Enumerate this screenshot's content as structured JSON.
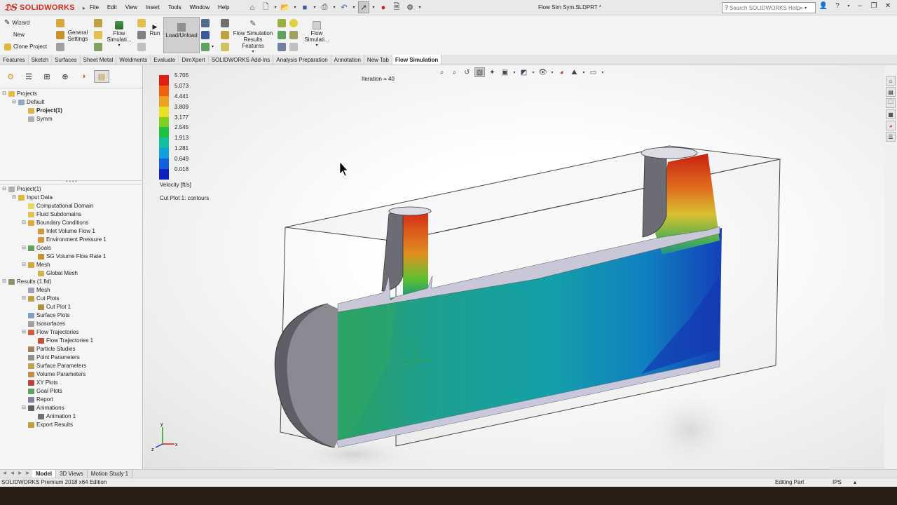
{
  "app": {
    "brand": "SOLIDWORKS",
    "document_title": "Flow Sim Sym.SLDPRT *",
    "menu": [
      "File",
      "Edit",
      "View",
      "Insert",
      "Tools",
      "Window",
      "Help"
    ],
    "search_placeholder": "Search SOLIDWORKS Help"
  },
  "ribbon": {
    "wizard": "Wizard",
    "new": "New",
    "clone_project": "Clone Project",
    "general_settings": "General Settings",
    "flow_simulation_1": "Flow Simulati...",
    "run": "Run",
    "load_unload": "Load/Unload",
    "results_features": "Flow Simulation Results Features",
    "flow_simulation_2": "Flow Simulati..."
  },
  "tabs": [
    {
      "label": "Features",
      "active": false
    },
    {
      "label": "Sketch",
      "active": false
    },
    {
      "label": "Surfaces",
      "active": false
    },
    {
      "label": "Sheet Metal",
      "active": false
    },
    {
      "label": "Weldments",
      "active": false
    },
    {
      "label": "Evaluate",
      "active": false
    },
    {
      "label": "DimXpert",
      "active": false
    },
    {
      "label": "SOLIDWORKS Add-Ins",
      "active": false
    },
    {
      "label": "Analysis Preparation",
      "active": false
    },
    {
      "label": "Annotation",
      "active": false
    },
    {
      "label": "New Tab",
      "active": false
    },
    {
      "label": "Flow Simulation",
      "active": true
    }
  ],
  "project_tree": [
    {
      "label": "Projects",
      "level": 0,
      "exp": "-",
      "icon": "#e8b84a",
      "bold": false
    },
    {
      "label": "Default",
      "level": 1,
      "exp": "-",
      "icon": "#8fa8c8",
      "bold": false
    },
    {
      "label": "Project(1)",
      "level": 2,
      "exp": "",
      "icon": "#d9b24a",
      "bold": true
    },
    {
      "label": "Symm",
      "level": 2,
      "exp": "",
      "icon": "#b0b0b0",
      "bold": false
    }
  ],
  "analysis_tree": [
    {
      "label": "Project(1)",
      "level": 0,
      "exp": "-",
      "icon": "#b0b0b0"
    },
    {
      "label": "Input Data",
      "level": 1,
      "exp": "-",
      "icon": "#e0b840"
    },
    {
      "label": "Computational Domain",
      "level": 2,
      "exp": "",
      "icon": "#e8d860"
    },
    {
      "label": "Fluid Subdomains",
      "level": 2,
      "exp": "",
      "icon": "#e0c050"
    },
    {
      "label": "Boundary Conditions",
      "level": 2,
      "exp": "-",
      "icon": "#e0a840"
    },
    {
      "label": "Inlet Volume Flow 1",
      "level": 3,
      "exp": "",
      "icon": "#d09840"
    },
    {
      "label": "Environment Pressure 1",
      "level": 3,
      "exp": "",
      "icon": "#d09840"
    },
    {
      "label": "Goals",
      "level": 2,
      "exp": "-",
      "icon": "#60a060"
    },
    {
      "label": "SG Volume Flow Rate 1",
      "level": 3,
      "exp": "",
      "icon": "#c89030"
    },
    {
      "label": "Mesh",
      "level": 2,
      "exp": "-",
      "icon": "#d0a840"
    },
    {
      "label": "Global Mesh",
      "level": 3,
      "exp": "",
      "icon": "#d0b050"
    },
    {
      "label": "Results (1.fld)",
      "level": 0,
      "exp": "-",
      "icon": "#909060"
    },
    {
      "label": "Mesh",
      "level": 2,
      "exp": "",
      "icon": "#a0a0c0"
    },
    {
      "label": "Cut Plots",
      "level": 2,
      "exp": "-",
      "icon": "#c0a040"
    },
    {
      "label": "Cut Plot 1",
      "level": 3,
      "exp": "",
      "icon": "#b09040"
    },
    {
      "label": "Surface Plots",
      "level": 2,
      "exp": "",
      "icon": "#80a0c0"
    },
    {
      "label": "Isosurfaces",
      "level": 2,
      "exp": "",
      "icon": "#a0a0a0"
    },
    {
      "label": "Flow Trajectories",
      "level": 2,
      "exp": "-",
      "icon": "#d06040"
    },
    {
      "label": "Flow Trajectories 1",
      "level": 3,
      "exp": "",
      "icon": "#c05040"
    },
    {
      "label": "Particle Studies",
      "level": 2,
      "exp": "",
      "icon": "#a08060"
    },
    {
      "label": "Point Parameters",
      "level": 2,
      "exp": "",
      "icon": "#909090"
    },
    {
      "label": "Surface Parameters",
      "level": 2,
      "exp": "",
      "icon": "#c0a050"
    },
    {
      "label": "Volume Parameters",
      "level": 2,
      "exp": "",
      "icon": "#c09050"
    },
    {
      "label": "XY Plots",
      "level": 2,
      "exp": "",
      "icon": "#c04040"
    },
    {
      "label": "Goal Plots",
      "level": 2,
      "exp": "",
      "icon": "#60a060"
    },
    {
      "label": "Report",
      "level": 2,
      "exp": "",
      "icon": "#8080a0"
    },
    {
      "label": "Animations",
      "level": 2,
      "exp": "-",
      "icon": "#606060"
    },
    {
      "label": "Animation 1",
      "level": 3,
      "exp": "",
      "icon": "#707070"
    },
    {
      "label": "Export Results",
      "level": 2,
      "exp": "",
      "icon": "#c0a040"
    }
  ],
  "viewport": {
    "iteration": "Iteration = 40",
    "legend_values": [
      "5.705",
      "5.073",
      "4.441",
      "3.809",
      "3.177",
      "2.545",
      "1.913",
      "1.281",
      "0.649",
      "0.018"
    ],
    "legend_colors": [
      "#e02010",
      "#f06010",
      "#f0a020",
      "#e8e020",
      "#80d020",
      "#20c040",
      "#10c0a0",
      "#10a0e0",
      "#1060e0",
      "#1020c0"
    ],
    "legend_title": "Velocity [ft/s]",
    "cut_plot_label": "Cut Plot 1: contours",
    "axis_x": "x",
    "axis_y": "y",
    "axis_z": "z"
  },
  "bottom_tabs": [
    {
      "label": "Model",
      "active": true
    },
    {
      "label": "3D Views",
      "active": false
    },
    {
      "label": "Motion Study 1",
      "active": false
    }
  ],
  "status": {
    "edition": "SOLIDWORKS Premium 2018 x64 Edition",
    "editing": "Editing Part",
    "units": "IPS",
    "arrow": "▴"
  }
}
